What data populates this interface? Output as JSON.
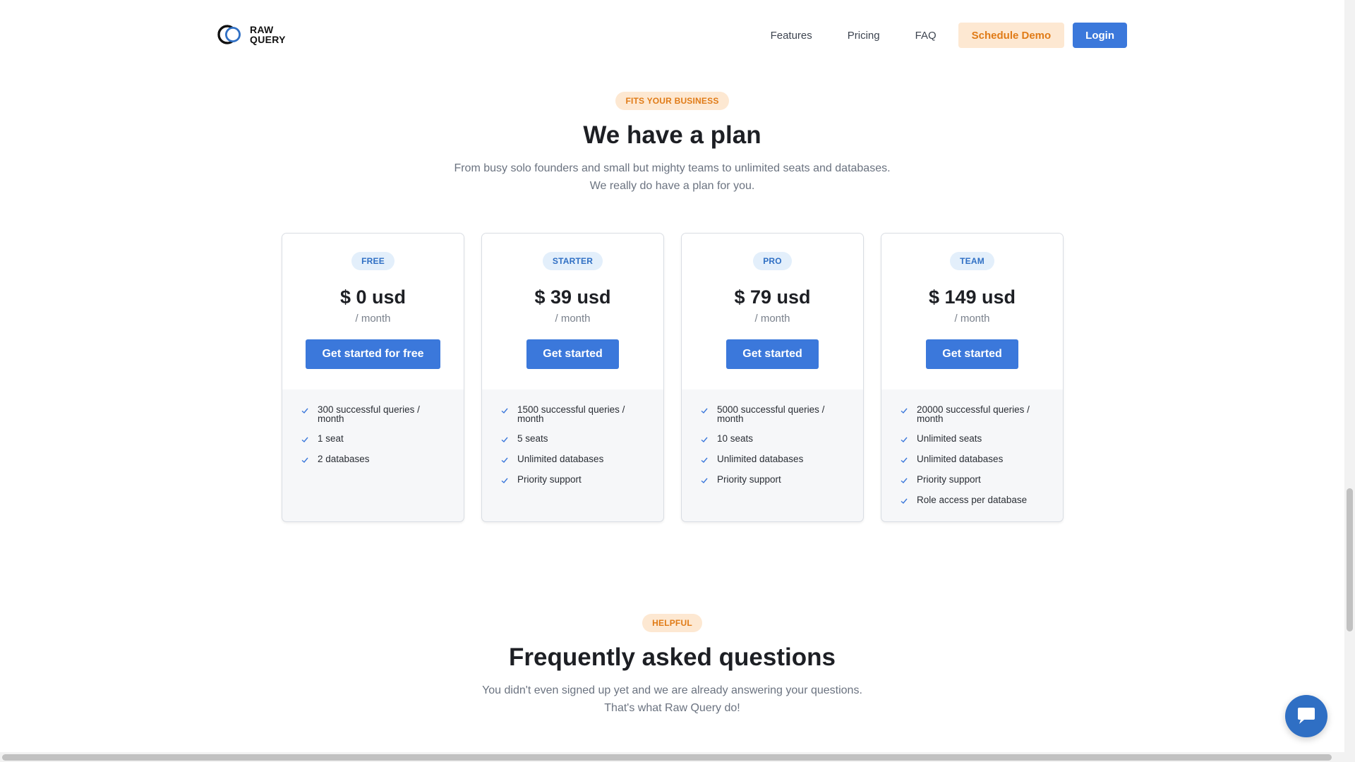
{
  "header": {
    "logo_line1": "RAW",
    "logo_line2": "QUERY",
    "nav": [
      "Features",
      "Pricing",
      "FAQ"
    ],
    "schedule_demo": "Schedule Demo",
    "login": "Login"
  },
  "pricing_section": {
    "badge": "FITS YOUR BUSINESS",
    "title": "We have a plan",
    "subtitle_line1": "From busy solo founders and small but mighty teams to unlimited seats and databases.",
    "subtitle_line2": "We really do have a plan for you."
  },
  "plans": [
    {
      "name": "FREE",
      "price": "$ 0 usd",
      "period": "/ month",
      "cta": "Get started for free",
      "features": [
        "300 successful queries / month",
        "1 seat",
        "2 databases"
      ]
    },
    {
      "name": "STARTER",
      "price": "$ 39 usd",
      "period": "/ month",
      "cta": "Get started",
      "features": [
        "1500 successful queries / month",
        "5 seats",
        "Unlimited databases",
        "Priority support"
      ]
    },
    {
      "name": "PRO",
      "price": "$ 79 usd",
      "period": "/ month",
      "cta": "Get started",
      "features": [
        "5000 successful queries / month",
        "10 seats",
        "Unlimited databases",
        "Priority support"
      ]
    },
    {
      "name": "TEAM",
      "price": "$ 149 usd",
      "period": "/ month",
      "cta": "Get started",
      "features": [
        "20000 successful queries / month",
        "Unlimited seats",
        "Unlimited databases",
        "Priority support",
        "Role access per database"
      ]
    }
  ],
  "faq_section": {
    "badge": "HELPFUL",
    "title": "Frequently asked questions",
    "subtitle_line1": "You didn't even signed up yet and we are already answering your questions.",
    "subtitle_line2": "That's what Raw Query do!"
  },
  "icons": {
    "check": "check-icon",
    "chat": "chat-icon"
  },
  "colors": {
    "accent_blue": "#3b78db",
    "accent_orange": "#e07b17",
    "orange_bg": "#fde8d2",
    "blue_pill_bg": "#e3effb"
  }
}
